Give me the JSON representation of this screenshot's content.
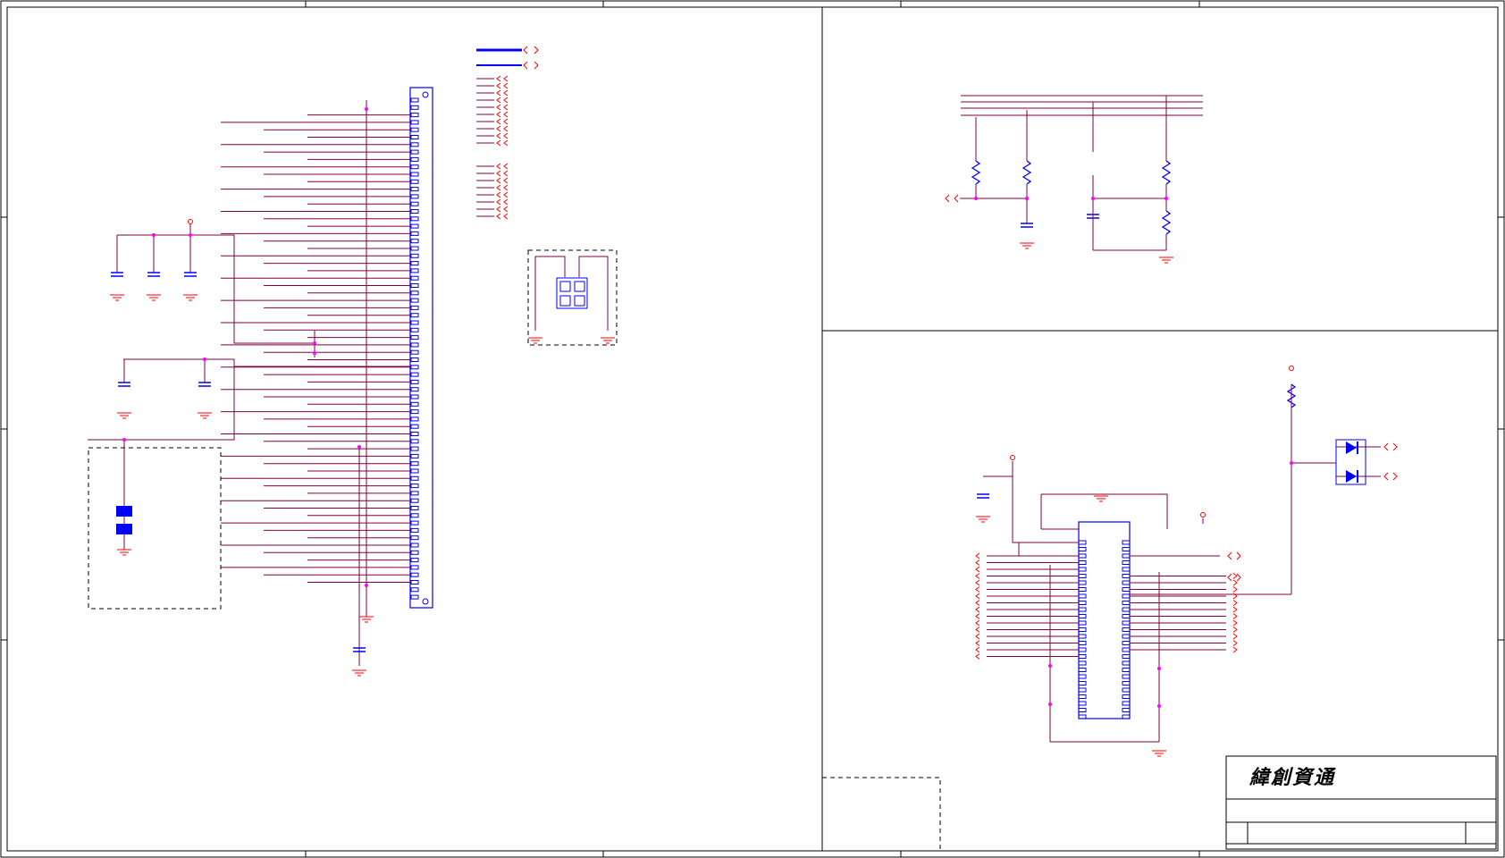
{
  "title_block": {
    "company_logo_text": "緯創資通"
  },
  "colors": {
    "wire": "#800040",
    "component": "#0000ff",
    "net_label": "#ff0000",
    "junction": "#ff00ff",
    "frame": "#000000",
    "background": "#ffffff"
  },
  "icons": {
    "net_flag": "double-chevron-icon",
    "resistor": "resistor-zigzag-icon",
    "capacitor": "capacitor-icon",
    "ground": "ground-icon",
    "diode": "diode-icon"
  }
}
